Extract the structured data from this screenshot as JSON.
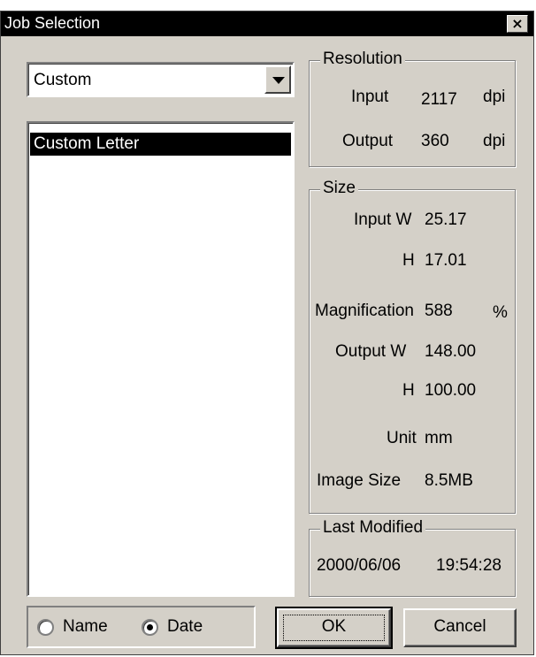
{
  "window": {
    "title": "Job Selection"
  },
  "category_select": {
    "value": "Custom"
  },
  "job_list": {
    "items": [
      {
        "label": "Custom Letter",
        "selected": true
      }
    ]
  },
  "resolution": {
    "title": "Resolution",
    "input_label": "Input",
    "input_value": "2117",
    "input_unit": "dpi",
    "output_label": "Output",
    "output_value": "360",
    "output_unit": "dpi"
  },
  "size": {
    "title": "Size",
    "input_w_label": "Input W",
    "input_w_value": "25.17",
    "input_h_label": "H",
    "input_h_value": "17.01",
    "magnification_label": "Magnification",
    "magnification_value": "588",
    "magnification_unit": "%",
    "output_w_label": "Output W",
    "output_w_value": "148.00",
    "output_h_label": "H",
    "output_h_value": "100.00",
    "unit_label": "Unit",
    "unit_value": "mm",
    "image_size_label": "Image Size",
    "image_size_value": "8.5MB"
  },
  "last_modified": {
    "title": "Last Modified",
    "date": "2000/06/06",
    "time": "19:54:28"
  },
  "sort": {
    "name_label": "Name",
    "date_label": "Date",
    "selected": "Date"
  },
  "buttons": {
    "ok": "OK",
    "cancel": "Cancel"
  },
  "icons": {
    "close": "close-icon",
    "dropdown": "chevron-down-icon"
  }
}
